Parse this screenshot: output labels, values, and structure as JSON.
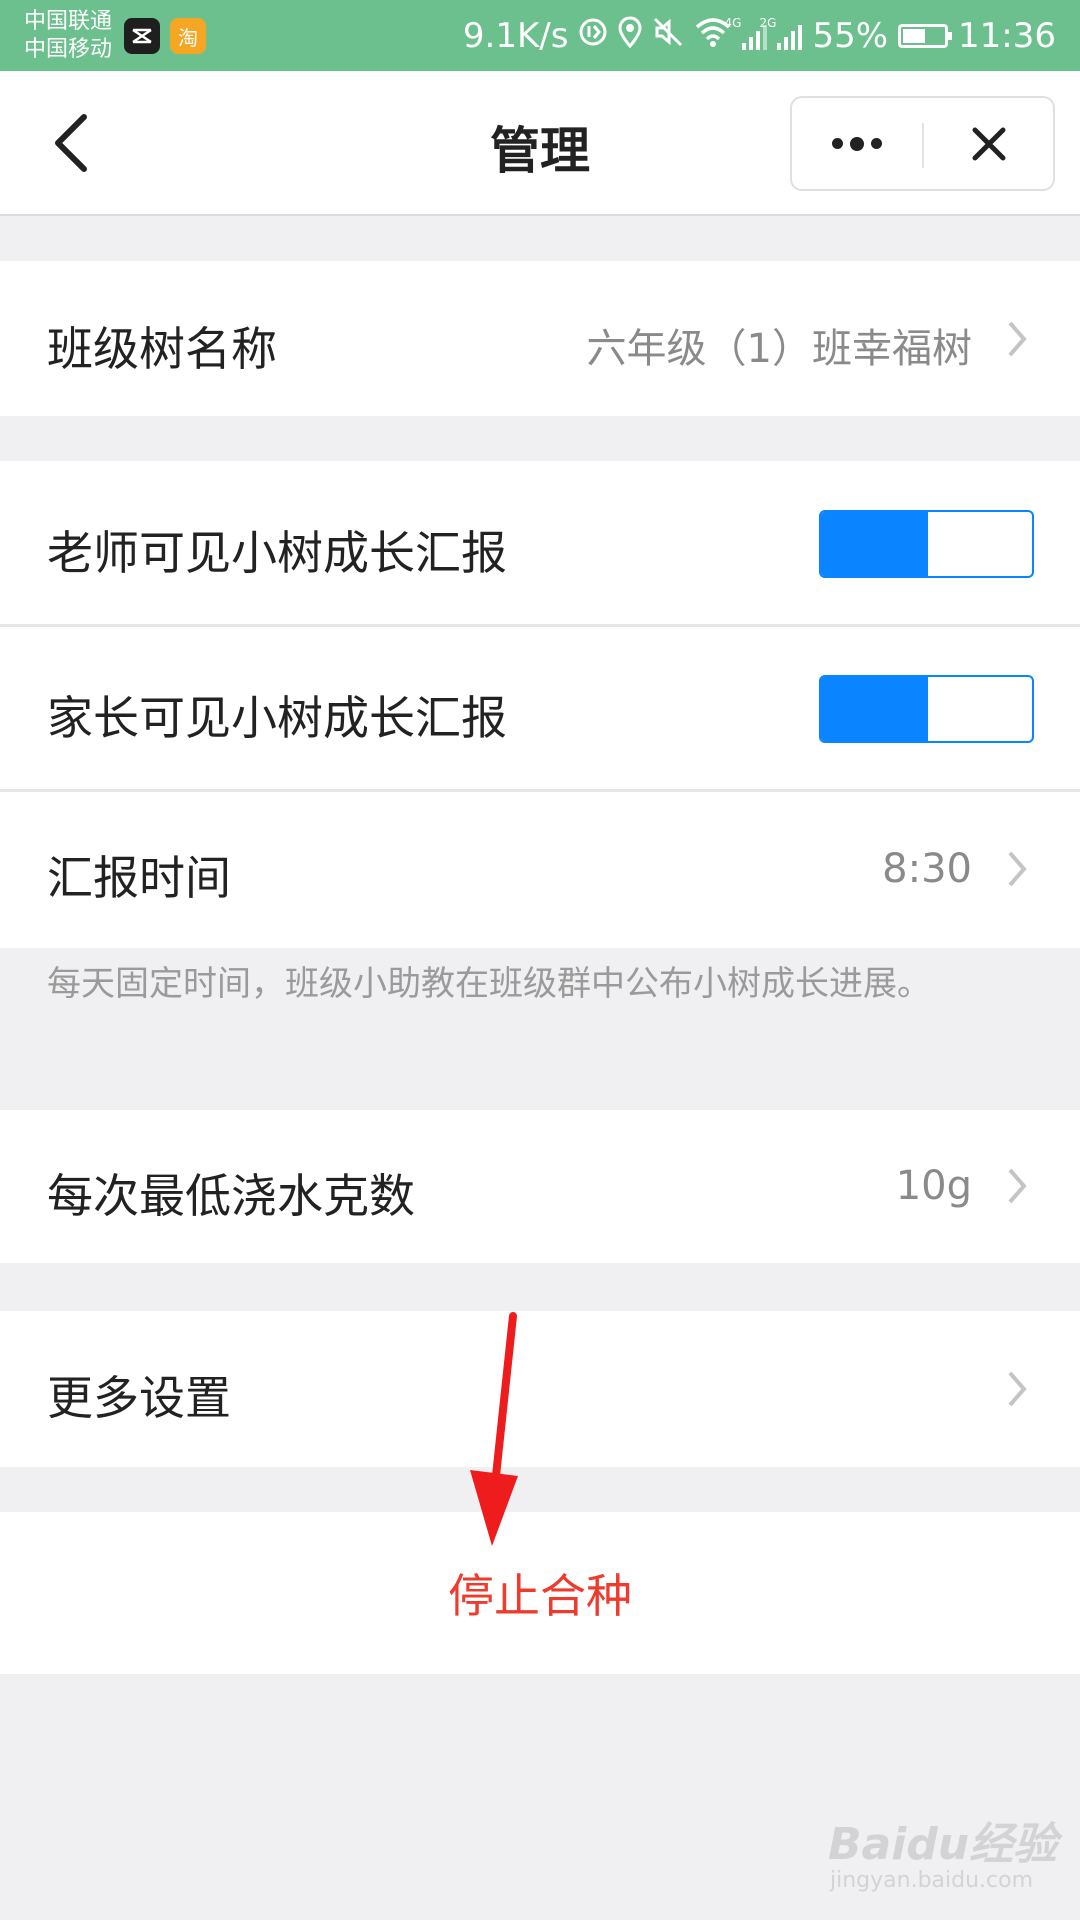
{
  "status_bar": {
    "carrier_1": "中国联通",
    "carrier_2": "中国移动",
    "taobao_glyph": "淘",
    "net_speed": "9.1K/s",
    "sig1_tag": "4G",
    "sig2_tag": "2G",
    "battery_text": "55%",
    "battery_level": 0.55,
    "time": "11:36",
    "bg_color": "#6cc08e"
  },
  "nav": {
    "title": "管理",
    "icons": [
      "back-arrow-icon",
      "more-dots-icon",
      "close-icon"
    ]
  },
  "settings": {
    "tree_name": {
      "label": "班级树名称",
      "value": "六年级（1）班幸福树"
    },
    "teacher_visible": {
      "label": "老师可见小树成长汇报",
      "enabled": true
    },
    "parent_visible": {
      "label": "家长可见小树成长汇报",
      "enabled": true
    },
    "report_time": {
      "label": "汇报时间",
      "value": "8:30"
    },
    "report_hint": "每天固定时间，班级小助教在班级群中公布小树成长进展。",
    "min_water": {
      "label": "每次最低浇水克数",
      "value": "10g"
    },
    "more_settings": {
      "label": "更多设置"
    }
  },
  "stop_button": {
    "label": "停止合种",
    "color": "#ee3b2e"
  },
  "toggle_color": "#0a84ff",
  "watermark": {
    "brand": "Baidu经验",
    "url": "jingyan.baidu.com"
  }
}
